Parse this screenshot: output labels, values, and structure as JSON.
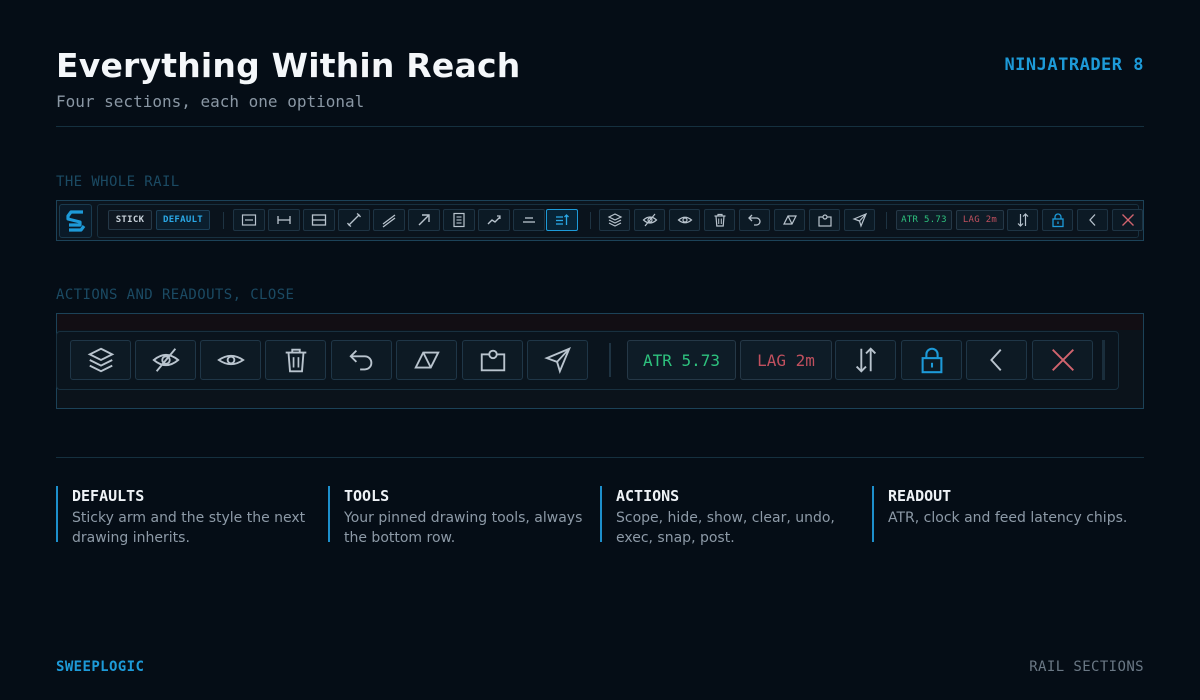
{
  "header": {
    "title": "Everything Within Reach",
    "subtitle": "Four sections, each one optional",
    "brand": "NINJATRADER 8"
  },
  "sections": {
    "whole_rail": "THE WHOLE RAIL",
    "actions_close": "ACTIONS AND READOUTS, CLOSE"
  },
  "rail": {
    "logo_icon": "sweeplogic-s-logo",
    "defaults": {
      "stick_label": "STICK",
      "default_label": "DEFAULT"
    },
    "tools": [
      {
        "icon": "horizontal-line-icon"
      },
      {
        "icon": "horizontal-ray-icon"
      },
      {
        "icon": "rectangle-icon"
      },
      {
        "icon": "ruler-icon"
      },
      {
        "icon": "parallel-channel-icon"
      },
      {
        "icon": "arrow-icon"
      },
      {
        "icon": "note-icon"
      },
      {
        "icon": "path-icon"
      },
      {
        "icon": "text-align-icon"
      },
      {
        "icon": "sort-tools-icon",
        "active": true
      }
    ],
    "actions": [
      {
        "icon": "layers-icon",
        "label": "Scope"
      },
      {
        "icon": "eye-off-icon",
        "label": "Hide"
      },
      {
        "icon": "eye-icon",
        "label": "Show"
      },
      {
        "icon": "trash-icon",
        "label": "Clear"
      },
      {
        "icon": "undo-icon",
        "label": "Undo"
      },
      {
        "icon": "exec-triangle-icon",
        "label": "Exec"
      },
      {
        "icon": "camera-icon",
        "label": "Snap"
      },
      {
        "icon": "send-icon",
        "label": "Post"
      }
    ],
    "readout": {
      "atr_label": "ATR 5.73",
      "lag_label": "LAG 2m",
      "sort_icon": "sort-arrows-icon",
      "lock_icon": "lock-icon",
      "collapse_icon": "chevron-left-icon",
      "close_icon": "close-icon"
    }
  },
  "legend": [
    {
      "title": "DEFAULTS",
      "desc": "Sticky arm and the style the next drawing inherits."
    },
    {
      "title": "TOOLS",
      "desc": "Your pinned drawing tools, always the bottom row."
    },
    {
      "title": "ACTIONS",
      "desc": "Scope, hide, show, clear, undo, exec, snap, post."
    },
    {
      "title": "READOUT",
      "desc": "ATR, clock and feed latency chips."
    }
  ],
  "footer": {
    "left": "SWEEPLOGIC",
    "right": "RAIL SECTIONS"
  },
  "colors": {
    "background": "#050d16",
    "accent": "#1d9ad8",
    "atr_green": "#2ec27e",
    "lag_red": "#c0505e",
    "close_red": "#d2646e"
  }
}
